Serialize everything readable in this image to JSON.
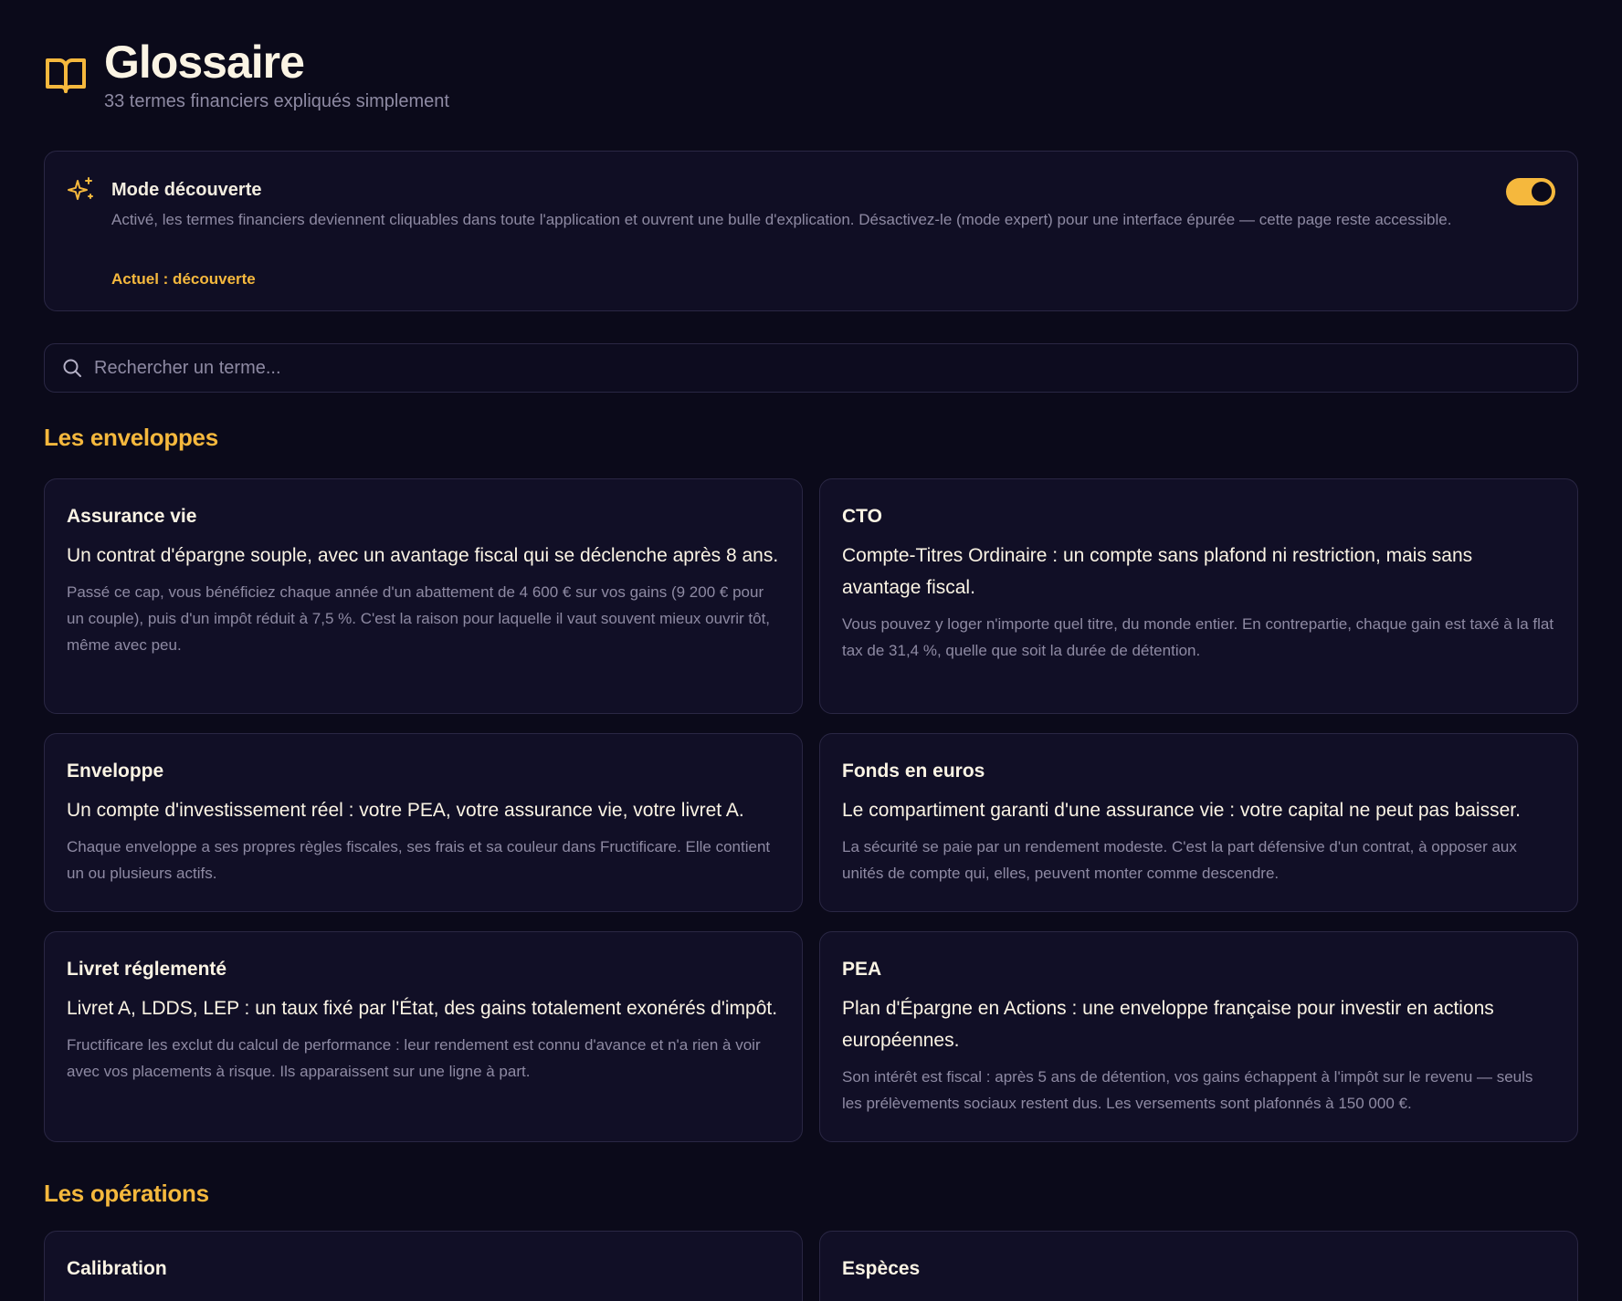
{
  "header": {
    "title": "Glossaire",
    "subtitle": "33 termes financiers expliqués simplement",
    "icon": "book-open-icon"
  },
  "mode": {
    "icon": "sparkles-icon",
    "title": "Mode découverte",
    "description": "Activé, les termes financiers deviennent cliquables dans toute l'application et ouvrent une bulle d'explication. Désactivez-le (mode expert) pour une interface épurée — cette page reste accessible.",
    "current": "Actuel : découverte",
    "enabled": true
  },
  "search": {
    "placeholder": "Rechercher un terme...",
    "value": ""
  },
  "sections": [
    {
      "title": "Les enveloppes",
      "cards": [
        {
          "title": "Assurance vie",
          "lead": "Un contrat d'épargne souple, avec un avantage fiscal qui se déclenche après 8 ans.",
          "body": "Passé ce cap, vous bénéficiez chaque année d'un abattement de 4 600 € sur vos gains (9 200 € pour un couple), puis d'un impôt réduit à 7,5 %. C'est la raison pour laquelle il vaut souvent mieux ouvrir tôt, même avec peu."
        },
        {
          "title": "CTO",
          "lead": "Compte-Titres Ordinaire : un compte sans plafond ni restriction, mais sans avantage fiscal.",
          "body": "Vous pouvez y loger n'importe quel titre, du monde entier. En contrepartie, chaque gain est taxé à la flat tax de 31,4 %, quelle que soit la durée de détention."
        },
        {
          "title": "Enveloppe",
          "lead": "Un compte d'investissement réel : votre PEA, votre assurance vie, votre livret A.",
          "body": "Chaque enveloppe a ses propres règles fiscales, ses frais et sa couleur dans Fructificare. Elle contient un ou plusieurs actifs."
        },
        {
          "title": "Fonds en euros",
          "lead": "Le compartiment garanti d'une assurance vie : votre capital ne peut pas baisser.",
          "body": "La sécurité se paie par un rendement modeste. C'est la part défensive d'un contrat, à opposer aux unités de compte qui, elles, peuvent monter comme descendre."
        },
        {
          "title": "Livret réglementé",
          "lead": "Livret A, LDDS, LEP : un taux fixé par l'État, des gains totalement exonérés d'impôt.",
          "body": "Fructificare les exclut du calcul de performance : leur rendement est connu d'avance et n'a rien à voir avec vos placements à risque. Ils apparaissent sur une ligne à part."
        },
        {
          "title": "PEA",
          "lead": "Plan d'Épargne en Actions : une enveloppe française pour investir en actions européennes.",
          "body": "Son intérêt est fiscal : après 5 ans de détention, vos gains échappent à l'impôt sur le revenu — seuls les prélèvements sociaux restent dus. Les versements sont plafonnés à 150 000 €."
        }
      ]
    },
    {
      "title": "Les opérations",
      "cards": [
        {
          "title": "Calibration"
        },
        {
          "title": "Espèces"
        }
      ]
    }
  ]
}
